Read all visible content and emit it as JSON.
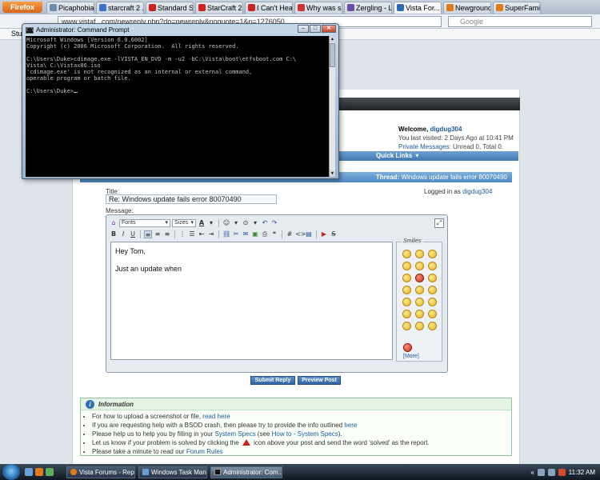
{
  "browser": {
    "app_button": "Firefox",
    "tabs": [
      {
        "label": "Picaphobia",
        "color": "#6a8caf"
      },
      {
        "label": "starcraft 2 ...",
        "color": "#3a73c9"
      },
      {
        "label": "Standard St...",
        "color": "#cc2222"
      },
      {
        "label": "StarCraft 2 ...",
        "color": "#cc2222"
      },
      {
        "label": "I Can't Hear...",
        "color": "#cc2222"
      },
      {
        "label": "Why was six...",
        "color": "#cc3333"
      },
      {
        "label": "Zergling - Li...",
        "color": "#6b4ca8"
      },
      {
        "label": "Vista For...",
        "color": "#2f6db3",
        "active": true
      },
      {
        "label": "Newground...",
        "color": "#e07b1a"
      },
      {
        "label": "SuperFamily",
        "color": "#e07b1a"
      }
    ],
    "url": "www.vistaf...com/newreply.php?do=newreply&noquote=1&p=1276050",
    "search_placeholder": "Google",
    "bookmark": "Stu"
  },
  "cmd": {
    "title": "Administrator: Command Prompt",
    "lines": [
      "Microsoft Windows [Version 6.0.6002]",
      "Copyright (c) 2006 Microsoft Corporation.  All rights reserved.",
      "",
      "C:\\Users\\Duke>cdimage.exe -lVISTA_EN_DVD -m -u2 -bC:\\Vista\\boot\\etfsboot.com C:\\",
      "Vista\\ C:\\Vistax86.iso",
      "'cdimage.exe' is not recognized as an internal or external command,",
      "operable program or batch file.",
      "",
      "C:\\Users\\Duke>"
    ]
  },
  "forum": {
    "welcome_label": "Welcome,",
    "username": "digdug304",
    "last_visited": "You last visited: 2 Days Ago at 10:41 PM",
    "pm_label": "Private Messages",
    "pm_status": ": Unread 0, Total 0.",
    "quick_links": "Quick Links",
    "thread_label": "Thread:",
    "thread_title": "Windows update fails error 80070490",
    "logged_in_label": "Logged in as",
    "logged_in_user": "digdug304",
    "title_label": "Title:",
    "title_value": "Re: Windows update fails error 80070490",
    "message_label": "Message:",
    "editor": {
      "font_select": "Fonts",
      "size_select": "Sizes",
      "body_lines": [
        "Hey Tom,",
        "Just an update when"
      ],
      "smilies_label": "Smilies",
      "more_label": "[More]"
    },
    "submit_label": "Submit Reply",
    "preview_label": "Preview Post",
    "info": {
      "heading": "Information",
      "items": [
        {
          "pre": "For how to upload a screenshot or file, ",
          "link": "read here",
          "post": ""
        },
        {
          "pre": "If you are requesting help with a BSOD crash, then please try to provide the info outlined ",
          "link": "here",
          "post": ""
        },
        {
          "pre": "Please help us to help you by filling in your ",
          "link": "System Specs",
          "mid": " (see ",
          "link2": "How to - System Specs",
          "post": ")."
        },
        {
          "pre": "Let us know if your problem is solved by clicking the ",
          "link": "",
          "post": " icon above your post and send the word 'solved' as the report."
        },
        {
          "pre": "Please take a minute to read our ",
          "link": "Forum Rules",
          "post": ""
        }
      ]
    }
  },
  "taskbar": {
    "tasks": [
      {
        "label": "Vista Forums - Repl...",
        "color": "#e07b1a"
      },
      {
        "label": "Windows Task Man...",
        "color": "#6a9bd1"
      },
      {
        "label": "Administrator: Com...",
        "color": "#111111",
        "active": true
      }
    ],
    "clock": "11:32 AM"
  }
}
